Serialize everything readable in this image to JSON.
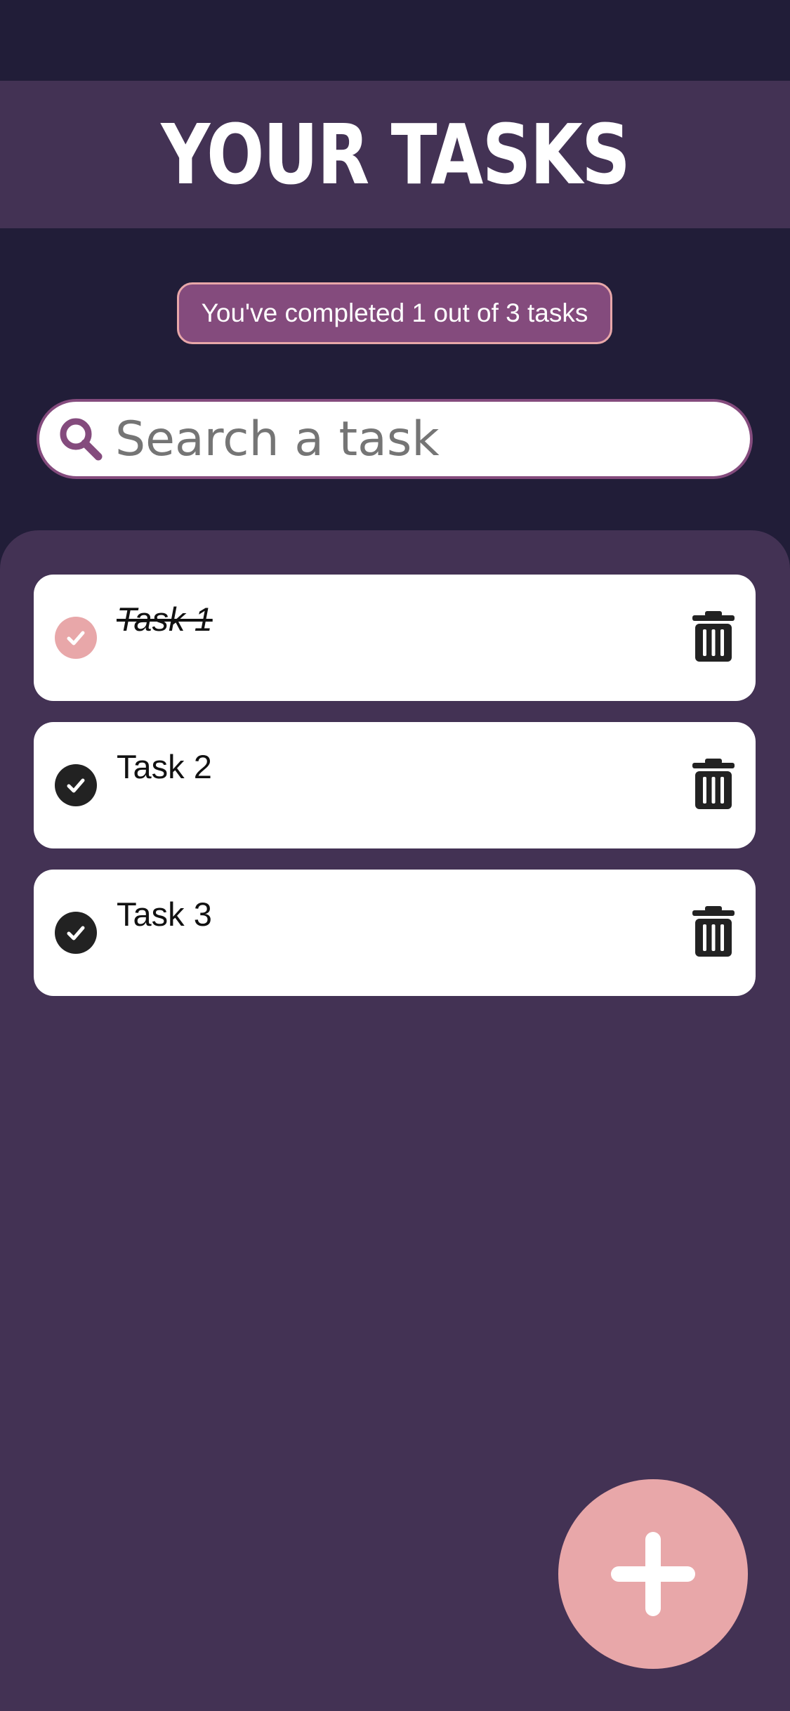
{
  "header": {
    "title": "YOUR TASKS"
  },
  "progress": {
    "text": "You've completed 1 out of 3 tasks",
    "completed": 1,
    "total": 3
  },
  "search": {
    "placeholder": "Search a task",
    "value": "",
    "icon": "search-icon"
  },
  "tasks": [
    {
      "label": "Task 1",
      "completed": true
    },
    {
      "label": "Task 2",
      "completed": false
    },
    {
      "label": "Task 3",
      "completed": false
    }
  ],
  "icons": {
    "check": "check-icon",
    "delete": "trash-icon",
    "add": "plus-icon"
  },
  "colors": {
    "background": "#211d38",
    "panel": "#433254",
    "accent": "#844b7d",
    "pink": "#e8a7a9",
    "card": "#ffffff",
    "dark": "#222222"
  }
}
